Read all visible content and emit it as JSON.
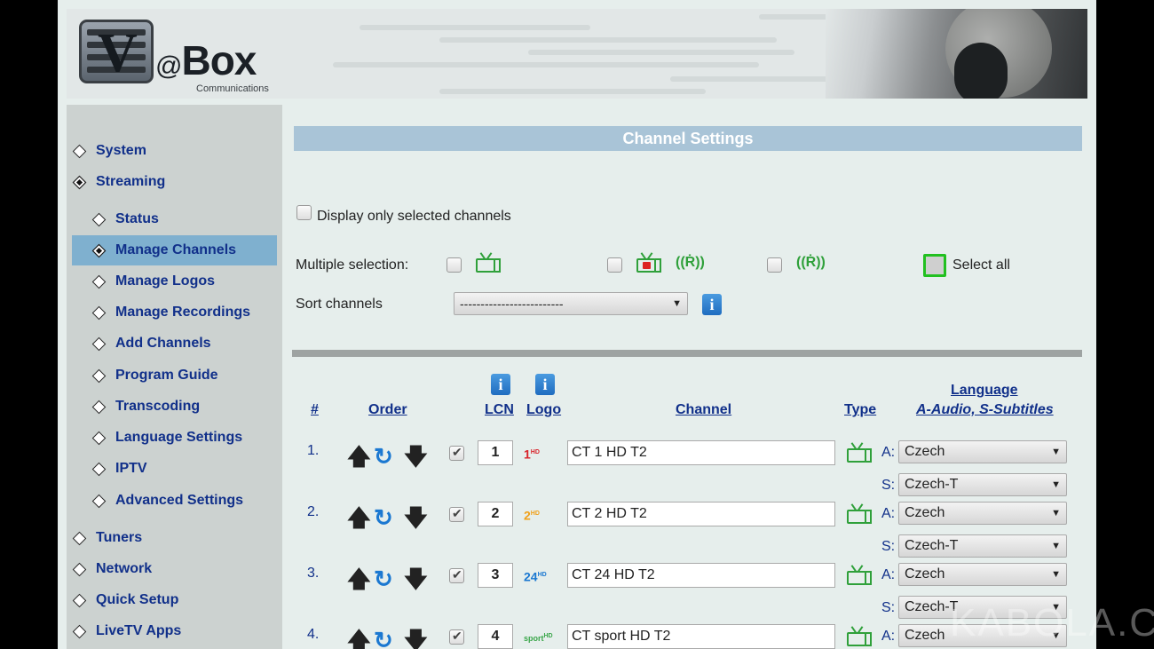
{
  "brand": {
    "logo_letter": "V",
    "logo_at": "@",
    "logo_name": "Box",
    "logo_sub": "Communications"
  },
  "sidebar": {
    "items": [
      {
        "label": "System"
      },
      {
        "label": "Streaming"
      },
      {
        "label": "Status"
      },
      {
        "label": "Manage Channels"
      },
      {
        "label": "Manage Logos"
      },
      {
        "label": "Manage Recordings"
      },
      {
        "label": "Add Channels"
      },
      {
        "label": "Program Guide"
      },
      {
        "label": "Transcoding"
      },
      {
        "label": "Language Settings"
      },
      {
        "label": "IPTV"
      },
      {
        "label": "Advanced Settings"
      },
      {
        "label": "Tuners"
      },
      {
        "label": "Network"
      },
      {
        "label": "Quick Setup"
      },
      {
        "label": "LiveTV Apps"
      }
    ]
  },
  "main": {
    "title": "Channel Settings",
    "display_only_selected": "Display only selected channels",
    "multiple_selection": "Multiple selection:",
    "select_all": "Select all",
    "sort_channels": "Sort channels",
    "sort_value": "-------------------------",
    "info": "i"
  },
  "table": {
    "headers": {
      "num": "#",
      "order": "Order",
      "lcn": "LCN",
      "logo": "Logo",
      "channel": "Channel",
      "type": "Type",
      "language": "Language",
      "language_sub": "A-Audio, S-Subtitles"
    },
    "audio_prefix": "A:",
    "subtitle_prefix": "S:",
    "rows": [
      {
        "num": "1.",
        "lcn": "1",
        "logo": "1",
        "logo_sup": "HD",
        "logo_color": "#d8232a",
        "name": "CT 1 HD T2",
        "audio": "Czech",
        "subtitles": "Czech-T"
      },
      {
        "num": "2.",
        "lcn": "2",
        "logo": "2",
        "logo_sup": "HD",
        "logo_color": "#f0a019",
        "name": "CT 2 HD T2",
        "audio": "Czech",
        "subtitles": "Czech-T"
      },
      {
        "num": "3.",
        "lcn": "3",
        "logo": "24",
        "logo_sup": "HD",
        "logo_color": "#1b78d1",
        "name": "CT 24 HD T2",
        "audio": "Czech",
        "subtitles": "Czech-T"
      },
      {
        "num": "4.",
        "lcn": "4",
        "logo": "sport",
        "logo_sup": "HD",
        "logo_color": "#3aa64a",
        "name": "CT sport HD T2",
        "audio": "Czech"
      }
    ]
  },
  "watermark": "KABOLA.CZ"
}
